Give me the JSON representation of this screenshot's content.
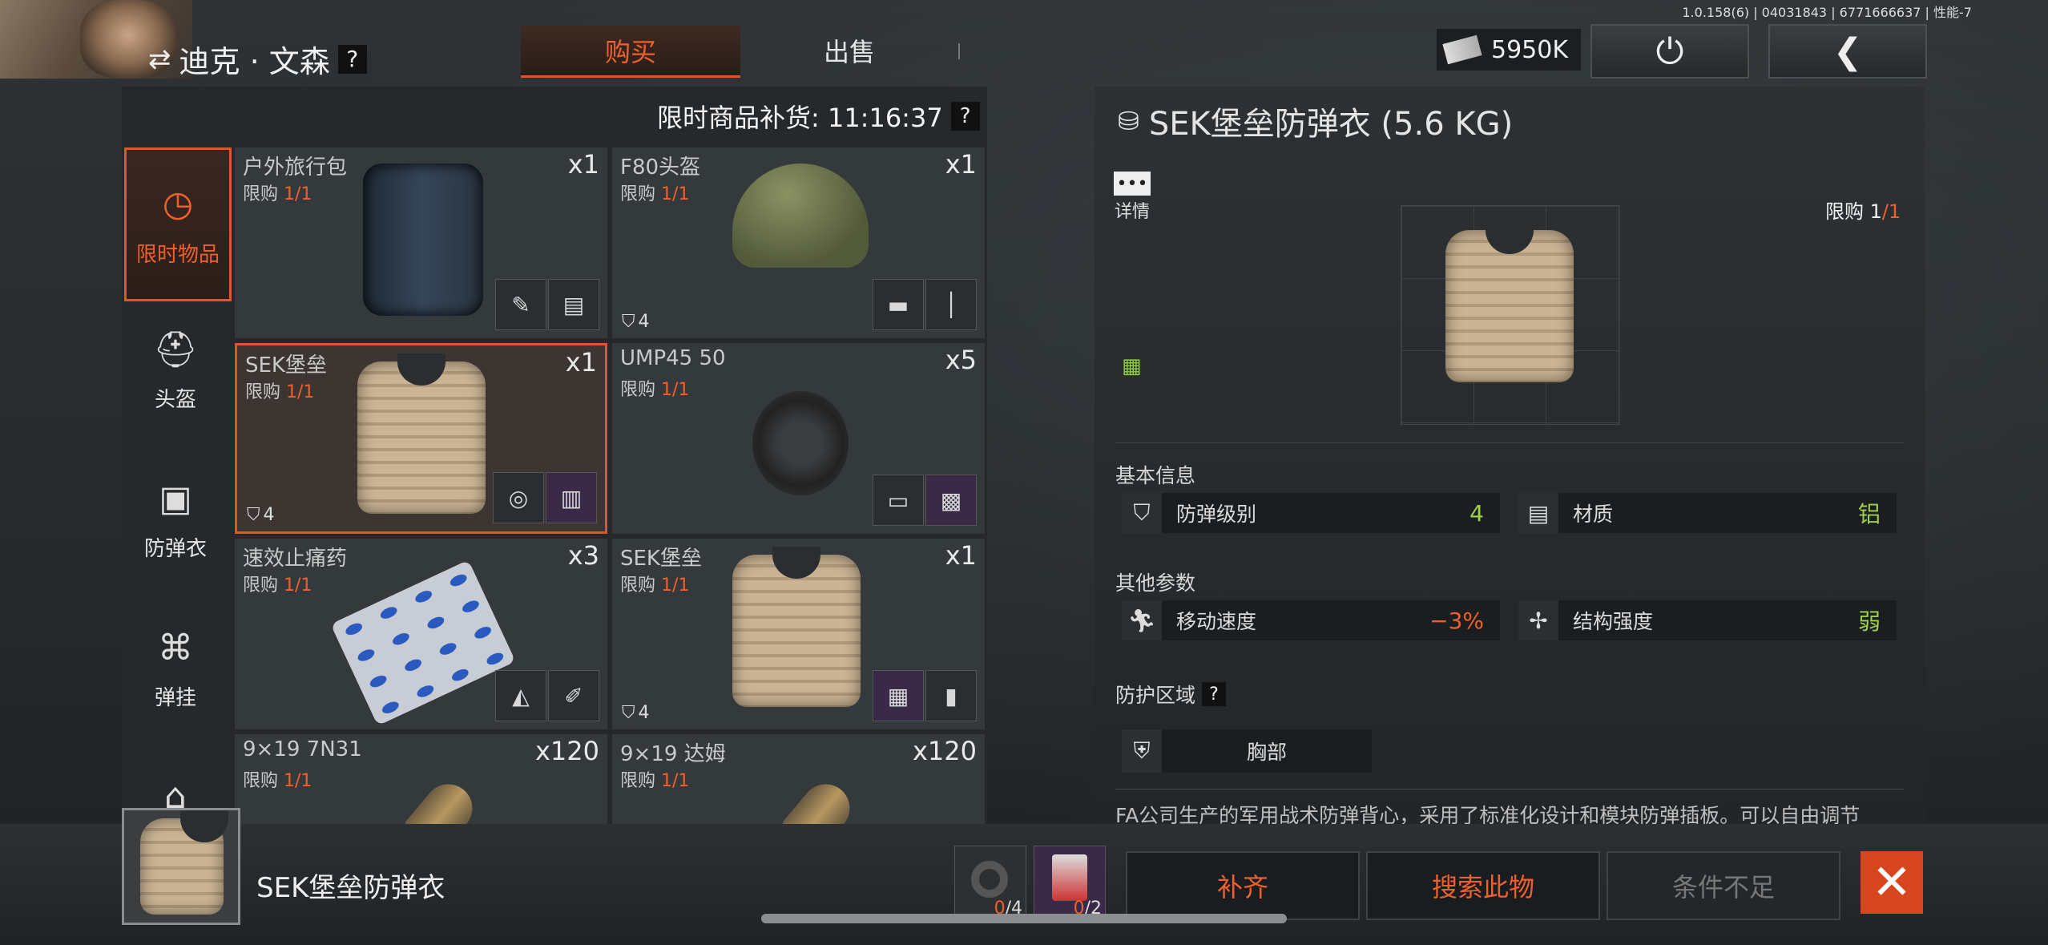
{
  "header": {
    "version": "1.0.158(6) | 04031843 | 6771666637 | 性能-7",
    "character_name": "迪克 · 文森",
    "help_mark": "?",
    "tabs": [
      {
        "label": "购买"
      },
      {
        "label": "出售"
      }
    ],
    "money": "5950K"
  },
  "shop": {
    "restock_text": "限时商品补货: 11:16:37",
    "help_mark": "?",
    "categories": [
      {
        "label": "限时物品",
        "icon": "clock-icon"
      },
      {
        "label": "头盔",
        "icon": "helmet-icon"
      },
      {
        "label": "防弹衣",
        "icon": "vest-icon"
      },
      {
        "label": "弹挂",
        "icon": "chest-rig-icon"
      }
    ],
    "limit_prefix": "限购 ",
    "items": [
      {
        "name": "户外旅行包",
        "limit": "1/1",
        "qty": "x1",
        "armor": ""
      },
      {
        "name": "F80头盔",
        "limit": "1/1",
        "qty": "x1",
        "armor": "4"
      },
      {
        "name": "SEK堡垒",
        "limit": "1/1",
        "qty": "x1",
        "armor": "4"
      },
      {
        "name": "UMP45 50",
        "limit": "1/1",
        "qty": "x5",
        "armor": ""
      },
      {
        "name": "速效止痛药",
        "limit": "1/1",
        "qty": "x3",
        "armor": ""
      },
      {
        "name": "SEK堡垒",
        "limit": "1/1",
        "qty": "x1",
        "armor": "4"
      },
      {
        "name": "9×19 7N31",
        "limit": "1/1",
        "qty": "x120",
        "armor": ""
      },
      {
        "name": "9×19 达姆",
        "limit": "1/1",
        "qty": "x120",
        "armor": ""
      }
    ]
  },
  "detail": {
    "title": "SEK堡垒防弹衣 (5.6 KG)",
    "details_label": "详情",
    "limit_label": "限购 1",
    "limit_value": "/1",
    "basic_info_label": "基本信息",
    "stats_basic": [
      {
        "label": "防弹级别",
        "value": "4",
        "icon": "shield-icon"
      },
      {
        "label": "材质",
        "value": "铝",
        "icon": "material-icon"
      }
    ],
    "other_params_label": "其他参数",
    "stats_other": [
      {
        "label": "移动速度",
        "value": "−3%",
        "icon": "running-icon"
      },
      {
        "label": "结构强度",
        "value": "弱",
        "icon": "structure-icon"
      }
    ],
    "protect_zone_label": "防护区域",
    "help_mark": "?",
    "zone": "胸部",
    "description": "FA公司生产的军用战术防弹背心，采用了标准化设计和模块防弹插板。可以自由调节"
  },
  "footer": {
    "selected_name": "SEK堡垒防弹衣",
    "materials": [
      {
        "have": "0",
        "need": "/4",
        "icon": "tape-roll-icon"
      },
      {
        "have": "0",
        "need": "/2",
        "icon": "snack-bag-icon"
      }
    ],
    "btn_fill": "补齐",
    "btn_search": "搜索此物",
    "btn_insufficient": "条件不足"
  },
  "colors": {
    "accent": "#f0602c",
    "positive": "#9fd04a",
    "background": "#23272a"
  }
}
